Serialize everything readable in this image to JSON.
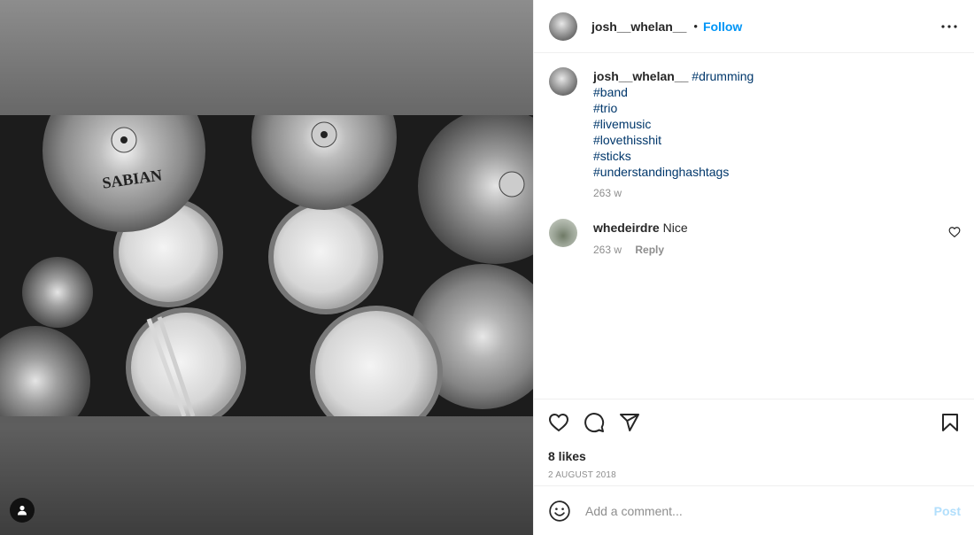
{
  "post": {
    "author": "josh__whelan__",
    "follow_label": "Follow",
    "separator": "•",
    "photo_brand_text": "SABIAN"
  },
  "caption": {
    "username": "josh__whelan__",
    "first_tag": "#drumming",
    "tags": [
      "#band",
      "#trio",
      "#livemusic",
      "#lovethisshit",
      "#sticks",
      "#understandinghashtags"
    ],
    "time": "263 w"
  },
  "comments": [
    {
      "username": "whedeirdre",
      "text": "Nice",
      "time": "263 w",
      "reply_label": "Reply"
    }
  ],
  "actions": {
    "likes": "8 likes",
    "date": "2 AUGUST 2018"
  },
  "comment_box": {
    "placeholder": "Add a comment...",
    "post_label": "Post"
  },
  "icons": {
    "more": "more-options-icon",
    "like": "heart-icon",
    "comment": "comment-icon",
    "share": "share-icon",
    "save": "bookmark-icon",
    "emoji": "emoji-icon",
    "user_tag": "user-tag-icon"
  },
  "colors": {
    "link": "#0095f6",
    "hashtag": "#00376b",
    "muted": "#8e8e8e",
    "post_disabled": "#b2dffc"
  }
}
